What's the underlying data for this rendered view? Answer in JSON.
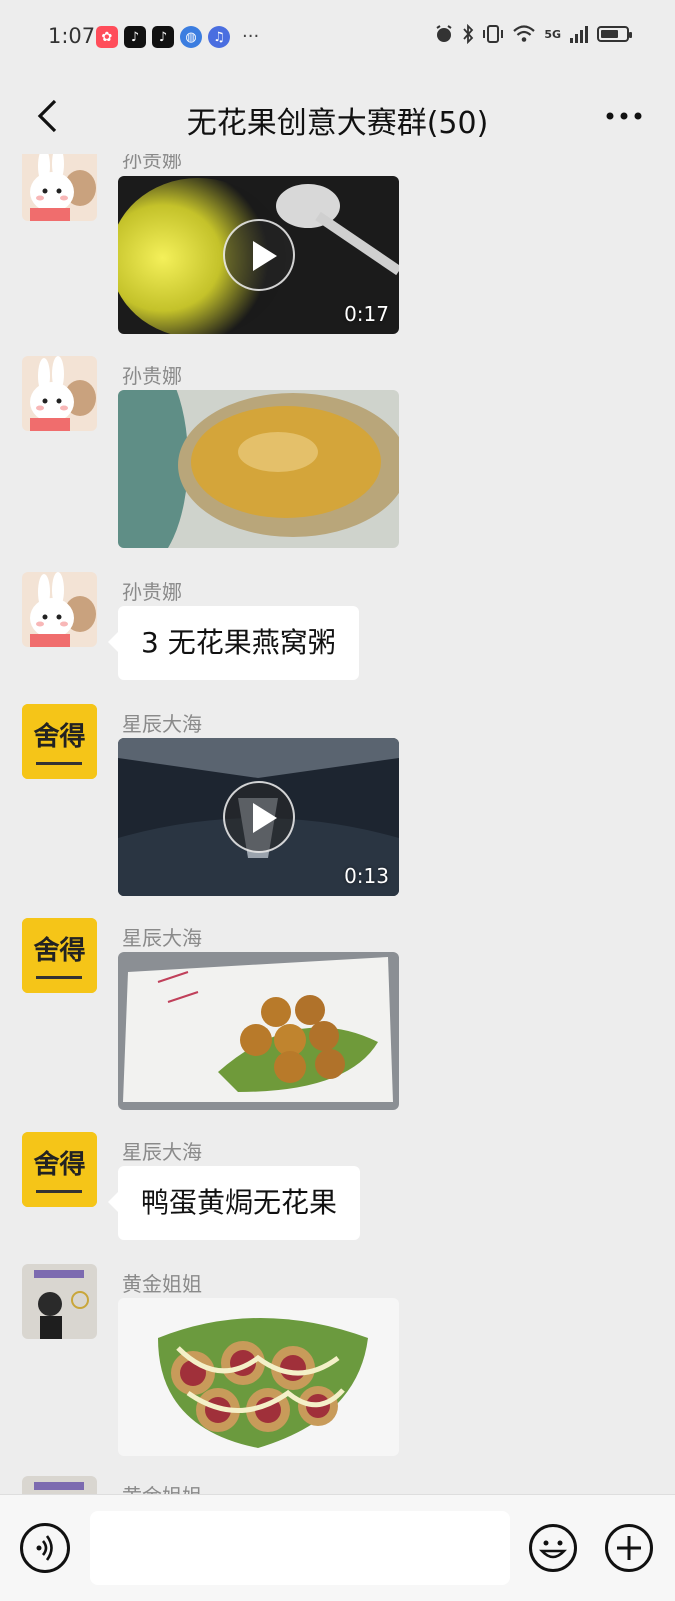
{
  "status_bar": {
    "time": "1:07",
    "app_icons": [
      "xiaohongshu-icon",
      "tiktok-lite-icon",
      "tiktok-icon",
      "browser-icon",
      "music-icon"
    ],
    "more": "···",
    "network": "5G"
  },
  "header": {
    "title": "无花果创意大赛群(50)"
  },
  "messages": [
    {
      "sender": "孙贵娜",
      "type": "video",
      "duration": "0:17"
    },
    {
      "sender": "孙贵娜",
      "type": "image"
    },
    {
      "sender": "孙贵娜",
      "type": "text",
      "text": "3 无花果燕窝粥"
    },
    {
      "sender": "星辰大海",
      "type": "video",
      "duration": "0:13"
    },
    {
      "sender": "星辰大海",
      "type": "image"
    },
    {
      "sender": "星辰大海",
      "type": "text",
      "text": "鸭蛋黄焗无花果"
    },
    {
      "sender": "黄金姐姐",
      "type": "image"
    },
    {
      "sender": "黄金姐姐",
      "type": "partial"
    }
  ],
  "avatars": {
    "rabbit_logo": "舍得"
  },
  "input": {
    "placeholder": ""
  },
  "colors": {
    "background": "#ededed",
    "bubble": "#ffffff",
    "sender_name": "#8a8a8a",
    "avatar_yellow": "#f5c518"
  }
}
